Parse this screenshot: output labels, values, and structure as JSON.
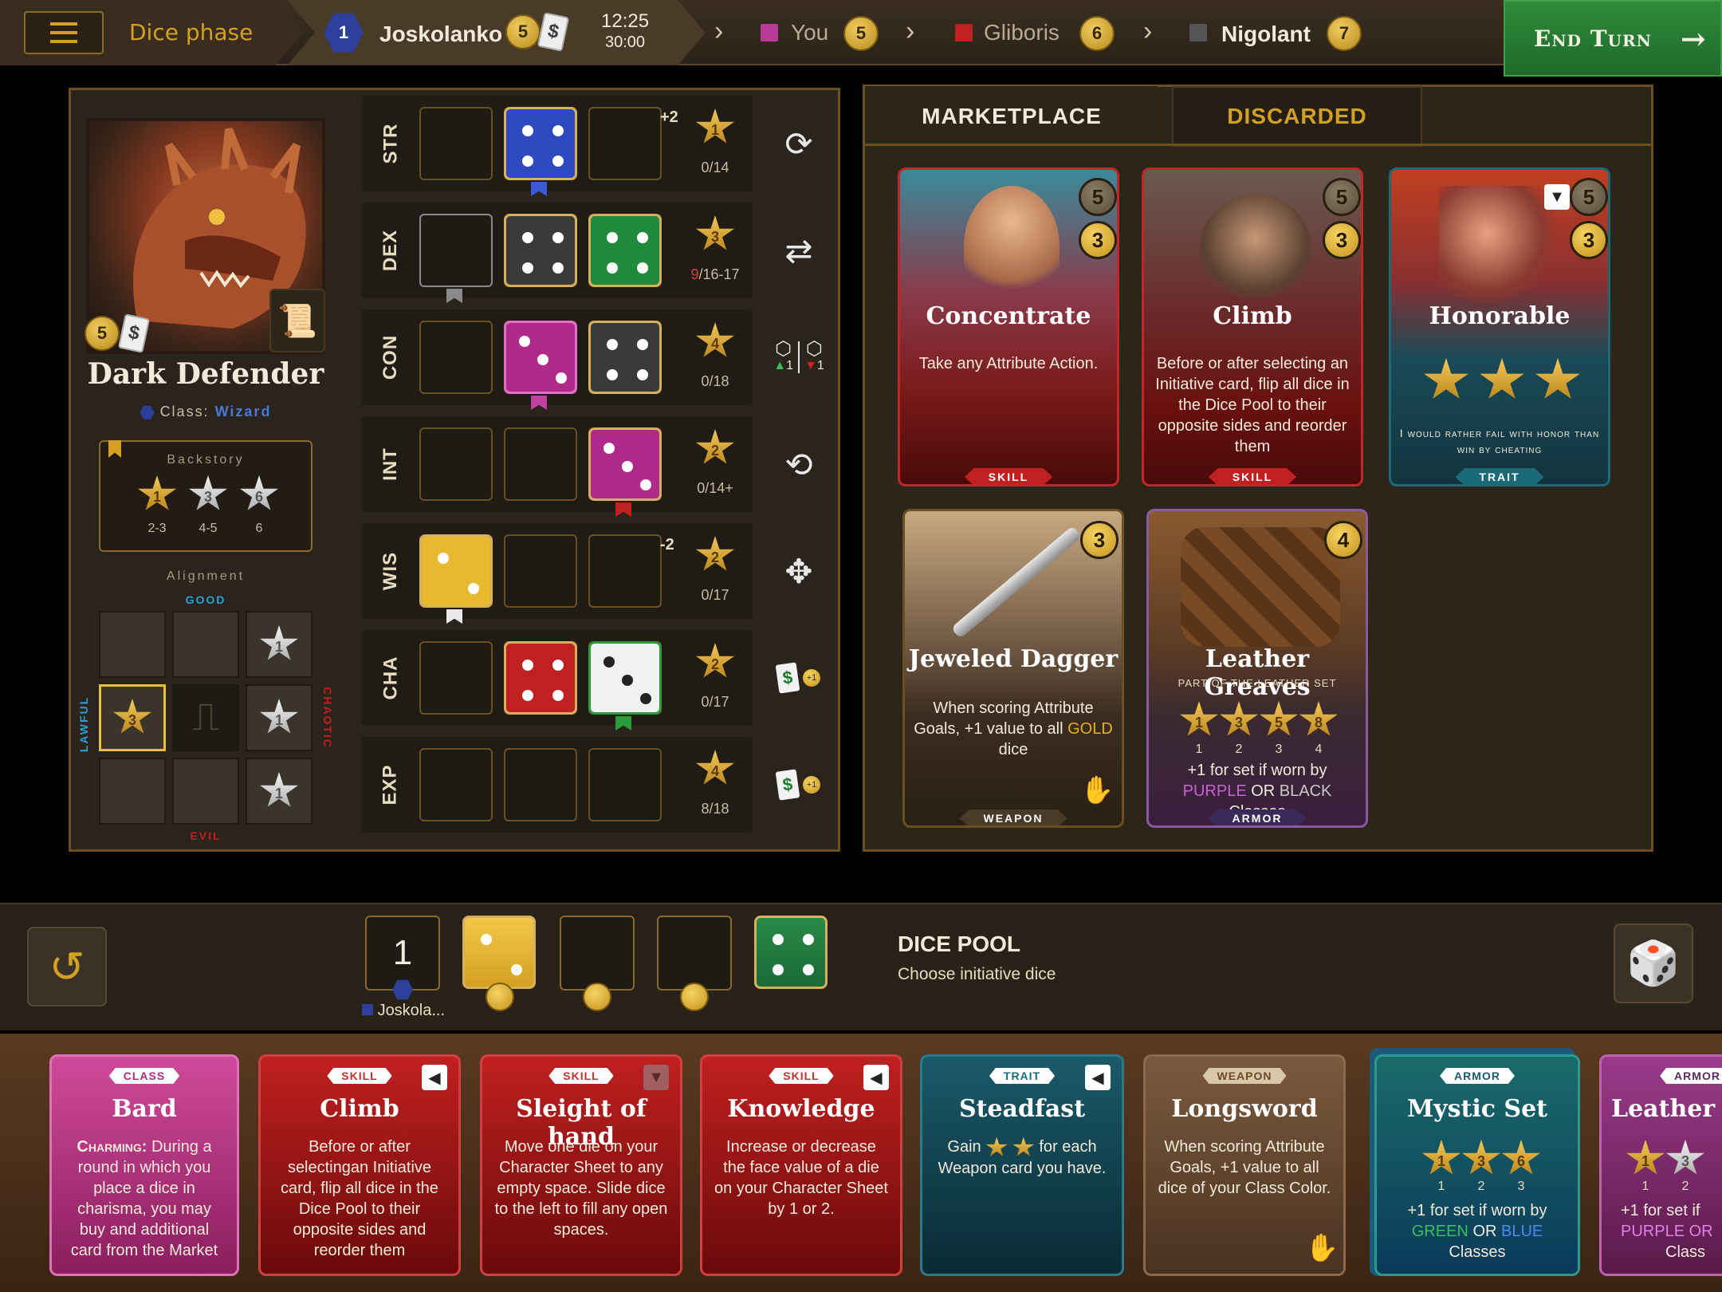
{
  "topbar": {
    "phase": "Dice phase",
    "active_player": {
      "order": "1",
      "name": "Joskolanko",
      "coins": "5",
      "timer_clock": "12:25",
      "timer_total": "30:00"
    },
    "players": [
      {
        "name": "You",
        "coins": "5",
        "color": "#b83a9a"
      },
      {
        "name": "Gliboris",
        "coins": "6",
        "color": "#c02020"
      },
      {
        "name": "Nigolant",
        "coins": "7",
        "color": "#555555"
      }
    ],
    "end_turn": "End Turn"
  },
  "character": {
    "coins": "5",
    "name": "Dark Defender",
    "class_prefix": "Class:",
    "class_name": "Wizard",
    "backstory_label": "Backstory",
    "backstory": [
      {
        "star": "1",
        "range": "2-3",
        "color": "gold"
      },
      {
        "star": "3",
        "range": "4-5",
        "color": "silver"
      },
      {
        "star": "6",
        "range": "6",
        "color": "silver"
      }
    ],
    "alignment_label": "Alignment",
    "good": "GOOD",
    "evil": "EVIL",
    "lawful": "LAWFUL",
    "chaotic": "CHAOTIC",
    "alignment_stars": [
      "1",
      "3",
      "1",
      "1"
    ]
  },
  "attributes": [
    {
      "name": "STR",
      "bonus": "+2",
      "star": "1",
      "goal_a": "",
      "goal_b": "0/14",
      "icon": "reroll-dice-icon"
    },
    {
      "name": "DEX",
      "bonus": "",
      "star": "3",
      "goal_a": "9",
      "goal_b": "/16-17",
      "icon": "swap-dice-icon"
    },
    {
      "name": "CON",
      "bonus": "",
      "star": "4",
      "goal_a": "",
      "goal_b": "0/18",
      "icon": "adjust-dice-icon"
    },
    {
      "name": "INT",
      "bonus": "",
      "star": "2",
      "goal_a": "",
      "goal_b": "0/14+",
      "icon": "cycle-dice-icon"
    },
    {
      "name": "WIS",
      "bonus": "-2",
      "star": "2",
      "goal_a": "",
      "goal_b": "0/17",
      "icon": "grid-dice-icon"
    },
    {
      "name": "CHA",
      "bonus": "",
      "star": "2",
      "goal_a": "",
      "goal_b": "0/17",
      "icon": "gold-card-icon"
    },
    {
      "name": "EXP",
      "bonus": "",
      "star": "4",
      "goal_a": "",
      "goal_b": "8/18",
      "icon": "gold-card-icon"
    }
  ],
  "con_mini": {
    "left": "1",
    "right": "1"
  },
  "coin_one": "+1",
  "market": {
    "tabs": [
      "MARKETPLACE",
      "DISCARDED"
    ],
    "cards": [
      {
        "title": "Concentrate",
        "text": "Take any Attribute Action.",
        "tag": "SKILL",
        "cost1": "5",
        "cost2": "3"
      },
      {
        "title": "Climb",
        "text": "Before or after selecting an Initiative card, flip all dice in the Dice Pool to their opposite sides and reorder them",
        "tag": "SKILL",
        "cost1": "5",
        "cost2": "3"
      },
      {
        "title": "Honorable",
        "text": "I would rather fail with honor than win by cheating",
        "tag": "TRAIT",
        "cost1": "5",
        "cost2": "3"
      },
      {
        "title": "Jeweled Dagger",
        "text_a": "When scoring Attribute Goals, +1 value to all",
        "text_gold": "GOLD",
        "text_b": "dice",
        "tag": "WEAPON",
        "cost": "3"
      },
      {
        "title": "Leather Greaves",
        "subtitle": "PART OF THE LEATHER SET",
        "stars": [
          "1",
          "3",
          "5",
          "8"
        ],
        "counts": [
          "1",
          "2",
          "3",
          "4"
        ],
        "text_a": "+1 for set if worn by",
        "purple": "PURPLE",
        "or": "OR",
        "black": "BLACK",
        "classes": "Classes",
        "tag": "ARMOR",
        "cost": "4"
      }
    ]
  },
  "dice_pool": {
    "title": "DICE POOL",
    "subtitle": "Choose initiative dice",
    "initiative": "1",
    "owner": "Joskola..."
  },
  "hand": [
    {
      "tag": "CLASS",
      "title": "Bard",
      "lead": "Charming:",
      "text": "During a round in which you place a dice in charisma, you may buy and additional card from the Market"
    },
    {
      "tag": "SKILL",
      "title": "Climb",
      "text": "Before or after selectingan Initiative card, flip all dice in the Dice Pool to their opposite sides and reorder them"
    },
    {
      "tag": "SKILL",
      "title": "Sleight of hand",
      "text": "Move one die on your Character Sheet to any empty space. Slide dice to the left to fill any open spaces."
    },
    {
      "tag": "SKILL",
      "title": "Knowledge",
      "text": "Increase or decrease the face value of a die on your Character Sheet by 1 or 2."
    },
    {
      "tag": "TRAIT",
      "title": "Steadfast",
      "text_a": "Gain",
      "text_b": "for each Weapon card you have."
    },
    {
      "tag": "WEAPON",
      "title": "Longsword",
      "text": "When scoring Attribute Goals, +1 value to all dice of your Class Color."
    },
    {
      "tag": "ARMOR",
      "title": "Mystic Set",
      "stars": [
        "1",
        "3",
        "6"
      ],
      "counts": [
        "1",
        "2",
        "3"
      ],
      "text_a": "+1 for set if worn by",
      "green": "GREEN",
      "or": "OR",
      "blue": "BLUE",
      "classes": "Classes"
    },
    {
      "tag": "ARMOR",
      "title": "Leather Gr",
      "stars": [
        "1",
        "3"
      ],
      "counts": [
        "1",
        "2"
      ],
      "text_a": "+1 for set if",
      "purple": "PURPLE OR",
      "classes": "Class"
    }
  ]
}
